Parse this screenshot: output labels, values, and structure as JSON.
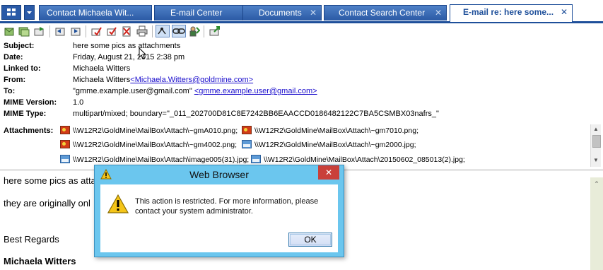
{
  "tabs": [
    {
      "label": "Contact Michaela Wit...",
      "active": false
    },
    {
      "label": "E-mail Center",
      "active": false
    },
    {
      "label": "Documents",
      "active": false
    },
    {
      "label": "Contact Search Center",
      "active": false
    },
    {
      "label": "E-mail re: here some...",
      "active": true
    }
  ],
  "tab_close_glyph": "✕",
  "toolbar": {
    "icons": [
      "reply-icon",
      "reply-all-icon",
      "forward-icon",
      "previous-icon",
      "next-icon",
      "flag-icon",
      "mark-read-icon",
      "delete-icon",
      "print-icon",
      "link-icon",
      "chain-link-icon",
      "attach-contact-icon",
      "export-icon"
    ]
  },
  "header": {
    "subject_label": "Subject:",
    "subject": "here some pics as attachments",
    "date_label": "Date:",
    "date": "Friday, August 21, 2015  2:38 pm",
    "linked_label": "Linked to:",
    "linked": "Michaela Witters",
    "from_label": "From:",
    "from_name": "Michaela Witters",
    "from_email": "<Michaela.Witters@goldmine.com>",
    "to_label": "To:",
    "to_name": "\"gmme.example.user@gmail.com\"",
    "to_email": "<gmme.example.user@gmail.com>",
    "mime_version_label": "MIME Version:",
    "mime_version": "1.0",
    "mime_type_label": "MIME Type:",
    "mime_type": "multipart/mixed; boundary=\"_011_202700D81C8E7242BB6EAACCD0186482122C7BA5CSMBX03nafrs_\""
  },
  "attachments": {
    "label": "Attachments:",
    "items": [
      "\\\\W12R2\\GoldMine\\MailBox\\Attach\\~gmA010.png;",
      "\\\\W12R2\\GoldMine\\MailBox\\Attach\\~gm7010.png;",
      "\\\\W12R2\\GoldMine\\MailBox\\Attach\\~gm4002.png;",
      "\\\\W12R2\\GoldMine\\MailBox\\Attach\\~gm2000.jpg;",
      "\\\\W12R2\\GoldMine\\MailBox\\Attach\\image005(31).jpg;",
      "\\\\W12R2\\GoldMine\\MailBox\\Attach\\20150602_085013(2).jpg;"
    ]
  },
  "body": {
    "line1": "here some pics as atta",
    "line2": "they are originally onl",
    "line3": "Best Regards",
    "line4": "Michaela Witters"
  },
  "dialog": {
    "title": "Web Browser",
    "message": "This action is restricted. For more information, please contact your system administrator.",
    "ok_label": "OK",
    "close_glyph": "✕"
  },
  "colors": {
    "tab_blue": "#2b5aa5",
    "dialog_frame": "#6bc6ee",
    "close_red": "#c9403a",
    "link": "#1a0dcc"
  }
}
